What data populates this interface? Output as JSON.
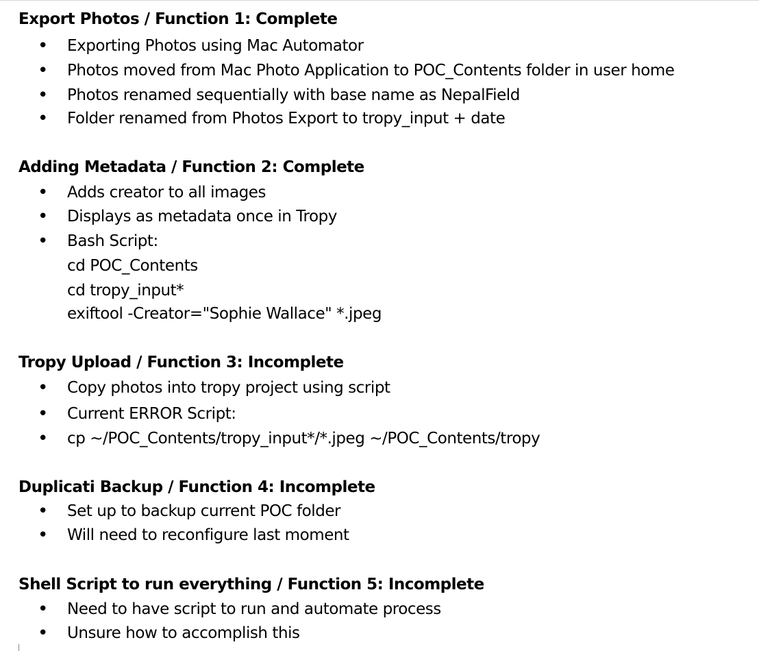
{
  "sections": [
    {
      "title": "Export Photos / Function 1: Complete",
      "items": [
        "Exporting Photos using Mac Automator",
        "Photos moved from Mac Photo Application  to POC_Contents folder in user home",
        "Photos renamed sequentially with base name as NepalField",
        "Folder renamed from Photos Export to tropy_input + date"
      ]
    },
    {
      "title": "Adding Metadata / Function 2: Complete",
      "items": [
        "Adds creator to all images",
        "Displays as metadata once in Tropy",
        "Bash Script:"
      ],
      "code_lines": [
        "cd POC_Contents",
        "cd tropy_input*",
        "exiftool -Creator=\"Sophie Wallace\" *.jpeg"
      ]
    },
    {
      "title": "Tropy Upload / Function 3: Incomplete",
      "items": [
        "Copy photos into tropy project using script",
        "Current ERROR Script:",
        "cp ~/POC_Contents/tropy_input*/*.jpeg ~/POC_Contents/tropy"
      ]
    },
    {
      "title": "Duplicati Backup / Function 4: Incomplete",
      "items": [
        "Set up to backup current POC folder",
        "Will need to reconfigure last moment"
      ]
    },
    {
      "title": "Shell Script to run everything / Function 5: Incomplete",
      "items": [
        "Need to have script to run and automate process",
        "Unsure how to accomplish this"
      ]
    }
  ],
  "bullet_glyph": "•"
}
